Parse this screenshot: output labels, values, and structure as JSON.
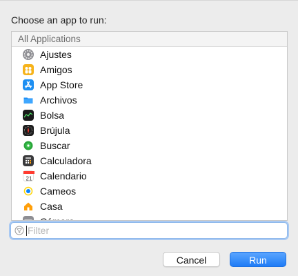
{
  "prompt": "Choose an app to run:",
  "list": {
    "header": "All Applications",
    "items": [
      {
        "label": "Ajustes",
        "icon": "gear-icon"
      },
      {
        "label": "Amigos",
        "icon": "people-icon"
      },
      {
        "label": "App Store",
        "icon": "app-store-icon"
      },
      {
        "label": "Archivos",
        "icon": "folder-icon"
      },
      {
        "label": "Bolsa",
        "icon": "stocks-icon"
      },
      {
        "label": "Brújula",
        "icon": "compass-icon"
      },
      {
        "label": "Buscar",
        "icon": "find-icon"
      },
      {
        "label": "Calculadora",
        "icon": "calculator-icon"
      },
      {
        "label": "Calendario",
        "icon": "calendar-icon"
      },
      {
        "label": "Cameos",
        "icon": "cameos-icon"
      },
      {
        "label": "Casa",
        "icon": "home-icon"
      },
      {
        "label": "Cámara",
        "icon": "camera-icon"
      }
    ]
  },
  "filter": {
    "placeholder": "Filter",
    "value": ""
  },
  "buttons": {
    "cancel": "Cancel",
    "run": "Run"
  },
  "colors": {
    "accent": "#1f7cf6",
    "focus_ring": "#a9c9f2"
  }
}
